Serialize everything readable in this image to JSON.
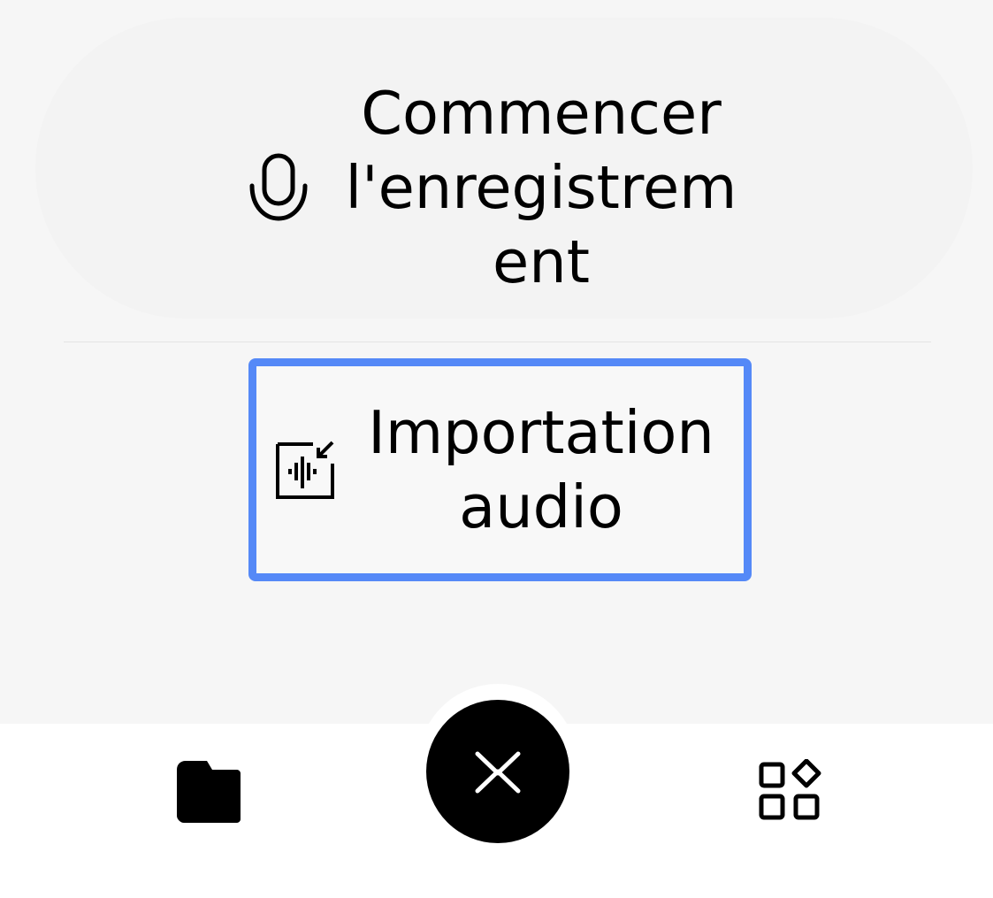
{
  "menu": {
    "record_label": "Commencer l'enregistrement",
    "import_label": "Importation audio"
  },
  "icons": {
    "record": "microphone-icon",
    "import": "audio-import-icon",
    "files": "folder-icon",
    "close": "close-icon",
    "apps": "apps-grid-icon"
  },
  "colors": {
    "focus_border": "#5589f7",
    "fab": "#000000",
    "panel": "#f6f6f6",
    "bottom_bar": "#ffffff"
  }
}
